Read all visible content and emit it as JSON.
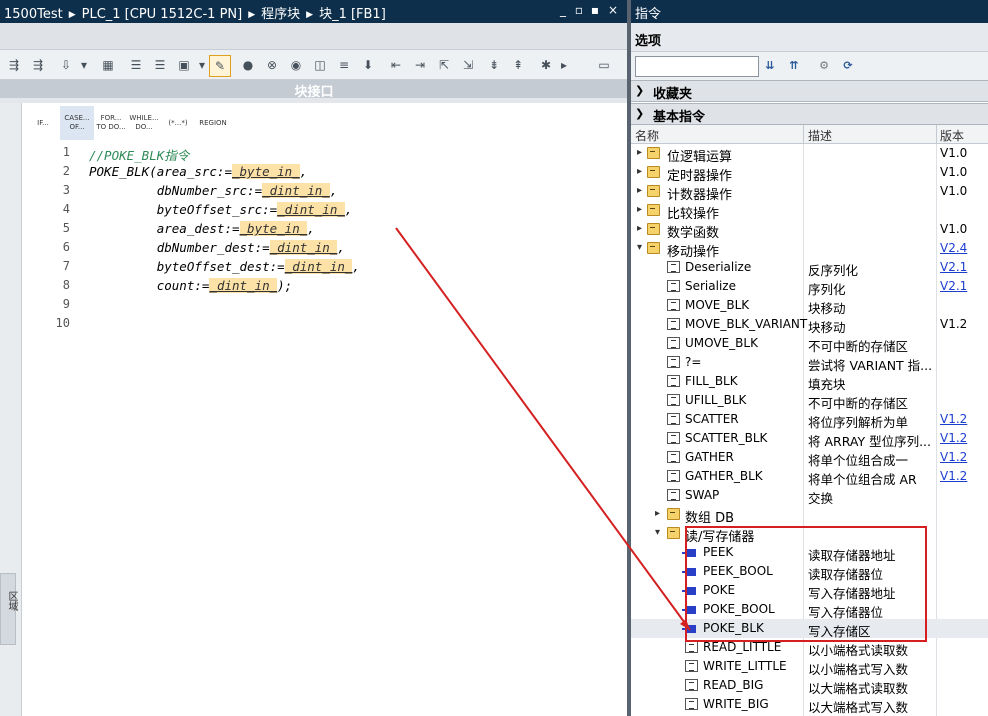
{
  "editor": {
    "breadcrumb": [
      "1500Test",
      "PLC_1 [CPU 1512C-1 PN]",
      "程序块",
      "块_1 [FB1]"
    ],
    "window_buttons": [
      "_",
      "▫",
      "▪",
      "×"
    ],
    "interface_header": "块接口",
    "side_tab_label": "区域",
    "scl_buttons": [
      {
        "line1": "IF...",
        "line2": ""
      },
      {
        "line1": "CASE...",
        "line2": "OF..."
      },
      {
        "line1": "FOR...",
        "line2": "TO DO..."
      },
      {
        "line1": "WHILE...",
        "line2": "DO..."
      },
      {
        "line1": "(*...*)",
        "line2": ""
      },
      {
        "line1": "REGION",
        "line2": ""
      }
    ],
    "code_lines": [
      {
        "num": "1",
        "parts": [
          {
            "t": "//POKE_BLK指令",
            "k": "comment"
          }
        ]
      },
      {
        "num": "2",
        "parts": [
          {
            "t": "POKE_BLK(area_src:=",
            "k": "code"
          },
          {
            "t": "_byte_in_",
            "k": "ph"
          },
          {
            "t": ",",
            "k": "code"
          }
        ]
      },
      {
        "num": "3",
        "parts": [
          {
            "t": "         dbNumber_src:=",
            "k": "code"
          },
          {
            "t": "_dint_in_",
            "k": "ph"
          },
          {
            "t": ",",
            "k": "code"
          }
        ]
      },
      {
        "num": "4",
        "parts": [
          {
            "t": "         byteOffset_src:=",
            "k": "code"
          },
          {
            "t": "_dint_in_",
            "k": "ph"
          },
          {
            "t": ",",
            "k": "code"
          }
        ]
      },
      {
        "num": "5",
        "parts": [
          {
            "t": "         area_dest:=",
            "k": "code"
          },
          {
            "t": "_byte_in_",
            "k": "ph"
          },
          {
            "t": ",",
            "k": "code"
          }
        ]
      },
      {
        "num": "6",
        "parts": [
          {
            "t": "         dbNumber_dest:=",
            "k": "code"
          },
          {
            "t": "_dint_in_",
            "k": "ph"
          },
          {
            "t": ",",
            "k": "code"
          }
        ]
      },
      {
        "num": "7",
        "parts": [
          {
            "t": "         byteOffset_dest:=",
            "k": "code"
          },
          {
            "t": "_dint_in_",
            "k": "ph"
          },
          {
            "t": ",",
            "k": "code"
          }
        ]
      },
      {
        "num": "8",
        "parts": [
          {
            "t": "         count:=",
            "k": "code"
          },
          {
            "t": "_dint_in_",
            "k": "ph"
          },
          {
            "t": ");",
            "k": "code"
          }
        ]
      },
      {
        "num": "9",
        "parts": []
      },
      {
        "num": "10",
        "parts": []
      }
    ]
  },
  "instructions": {
    "title": "指令",
    "options_label": "选项",
    "search_placeholder": "",
    "favorites_label": "收藏夹",
    "basic_label": "基本指令",
    "columns": {
      "name": "名称",
      "desc": "描述",
      "version": "版本"
    },
    "rows": [
      {
        "level": 0,
        "exp": "▸",
        "icon": "fold",
        "name": "位逻辑运算",
        "desc": "",
        "ver": "V1.0",
        "link": false
      },
      {
        "level": 0,
        "exp": "▸",
        "icon": "fold",
        "name": "定时器操作",
        "desc": "",
        "ver": "V1.0",
        "link": false
      },
      {
        "level": 0,
        "exp": "▸",
        "icon": "fold",
        "name": "计数器操作",
        "desc": "",
        "ver": "V1.0",
        "link": false
      },
      {
        "level": 0,
        "exp": "▸",
        "icon": "fold",
        "name": "比较操作",
        "desc": "",
        "ver": "",
        "link": false
      },
      {
        "level": 0,
        "exp": "▸",
        "icon": "fold",
        "name": "数学函数",
        "desc": "",
        "ver": "V1.0",
        "link": false
      },
      {
        "level": 0,
        "exp": "▾",
        "icon": "fold",
        "name": "移动操作",
        "desc": "",
        "ver": "V2.4",
        "link": true
      },
      {
        "level": 1,
        "exp": "",
        "icon": "blk",
        "name": "Deserialize",
        "desc": "反序列化",
        "ver": "V2.1",
        "link": true
      },
      {
        "level": 1,
        "exp": "",
        "icon": "blk",
        "name": "Serialize",
        "desc": "序列化",
        "ver": "V2.1",
        "link": true
      },
      {
        "level": 1,
        "exp": "",
        "icon": "blk",
        "name": "MOVE_BLK",
        "desc": "块移动",
        "ver": "",
        "link": false
      },
      {
        "level": 1,
        "exp": "",
        "icon": "blk",
        "name": "MOVE_BLK_VARIANT",
        "desc": "块移动",
        "ver": "V1.2",
        "link": false
      },
      {
        "level": 1,
        "exp": "",
        "icon": "blk",
        "name": "UMOVE_BLK",
        "desc": "不可中断的存储区",
        "ver": "",
        "link": false
      },
      {
        "level": 1,
        "exp": "",
        "icon": "blk",
        "name": "?=",
        "desc": "尝试将 VARIANT 指...",
        "ver": "",
        "link": false
      },
      {
        "level": 1,
        "exp": "",
        "icon": "blk",
        "name": "FILL_BLK",
        "desc": "填充块",
        "ver": "",
        "link": false
      },
      {
        "level": 1,
        "exp": "",
        "icon": "blk",
        "name": "UFILL_BLK",
        "desc": "不可中断的存储区",
        "ver": "",
        "link": false
      },
      {
        "level": 1,
        "exp": "",
        "icon": "blk",
        "name": "SCATTER",
        "desc": "将位序列解析为单",
        "ver": "V1.2",
        "link": true
      },
      {
        "level": 1,
        "exp": "",
        "icon": "blk",
        "name": "SCATTER_BLK",
        "desc": "将 ARRAY 型位序列...",
        "ver": "V1.2",
        "link": true
      },
      {
        "level": 1,
        "exp": "",
        "icon": "blk",
        "name": "GATHER",
        "desc": "将单个位组合成一",
        "ver": "V1.2",
        "link": true
      },
      {
        "level": 1,
        "exp": "",
        "icon": "blk",
        "name": "GATHER_BLK",
        "desc": "将单个位组合成 AR",
        "ver": "V1.2",
        "link": true
      },
      {
        "level": 1,
        "exp": "",
        "icon": "blk",
        "name": "SWAP",
        "desc": "交换",
        "ver": "",
        "link": false
      },
      {
        "level": 1,
        "exp": "▸",
        "icon": "fold",
        "name": "数组 DB",
        "desc": "",
        "ver": "",
        "link": false
      },
      {
        "level": 1,
        "exp": "▾",
        "icon": "fold",
        "name": "读/写存储器",
        "desc": "",
        "ver": "",
        "link": false
      },
      {
        "level": 2,
        "exp": "",
        "icon": "blue",
        "name": "PEEK",
        "desc": "读取存储器地址",
        "ver": "",
        "link": false
      },
      {
        "level": 2,
        "exp": "",
        "icon": "blue",
        "name": "PEEK_BOOL",
        "desc": "读取存储器位",
        "ver": "",
        "link": false
      },
      {
        "level": 2,
        "exp": "",
        "icon": "blue",
        "name": "POKE",
        "desc": "写入存储器地址",
        "ver": "",
        "link": false
      },
      {
        "level": 2,
        "exp": "",
        "icon": "blue",
        "name": "POKE_BOOL",
        "desc": "写入存储器位",
        "ver": "",
        "link": false
      },
      {
        "level": 2,
        "exp": "",
        "icon": "blue",
        "name": "POKE_BLK",
        "desc": "写入存储区",
        "ver": "",
        "link": false,
        "highlight": true
      },
      {
        "level": 2,
        "exp": "",
        "icon": "blk",
        "name": "READ_LITTLE",
        "desc": "以小端格式读取数",
        "ver": "",
        "link": false
      },
      {
        "level": 2,
        "exp": "",
        "icon": "blk",
        "name": "WRITE_LITTLE",
        "desc": "以小端格式写入数",
        "ver": "",
        "link": false
      },
      {
        "level": 2,
        "exp": "",
        "icon": "blk",
        "name": "READ_BIG",
        "desc": "以大端格式读取数",
        "ver": "",
        "link": false
      },
      {
        "level": 2,
        "exp": "",
        "icon": "blk",
        "name": "WRITE_BIG",
        "desc": "以大端格式写入数",
        "ver": "",
        "link": false
      }
    ]
  },
  "colors": {
    "annotation": "#d42020",
    "link": "#1d3fd0",
    "titlebar": "#0e2f4b"
  }
}
